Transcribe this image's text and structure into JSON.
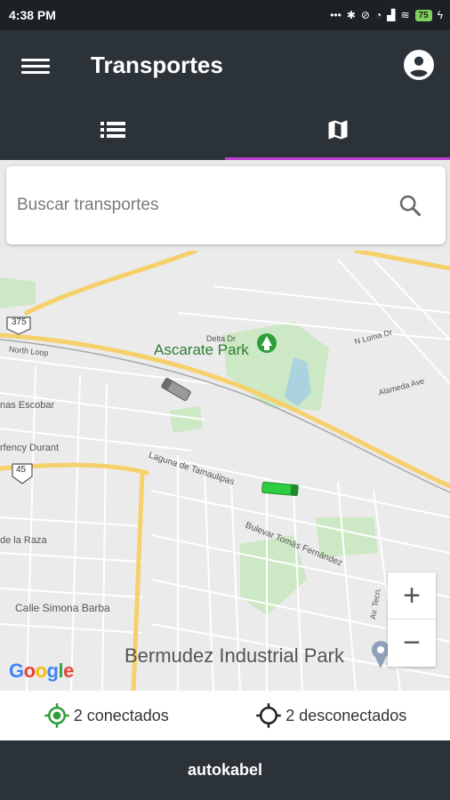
{
  "status_bar": {
    "time": "4:38 PM",
    "icons": [
      "dots-icon",
      "bluetooth-icon",
      "mute-icon",
      "alarm-icon",
      "signal-icon",
      "wifi-icon",
      "battery-icon",
      "charging-icon"
    ],
    "battery_level": "75"
  },
  "app_bar": {
    "title": "Transportes",
    "menu_icon": "hamburger-menu-icon",
    "account_icon": "account-circle-icon"
  },
  "tabs": [
    {
      "icon": "list-icon",
      "active": false
    },
    {
      "icon": "map-icon",
      "active": true
    }
  ],
  "colors": {
    "tab_indicator": "#c13bd6",
    "connected": "#2e9e3a",
    "disconnected": "#222222",
    "appbar": "#2b3238"
  },
  "search": {
    "placeholder": "Buscar transportes",
    "icon": "search-icon"
  },
  "map": {
    "labels": {
      "ascarate_park": "Ascarate Park",
      "bermudez_park": "Bermudez Industrial Park",
      "calle_simona": "Calle Simona Barba",
      "escobar": "nas Escobar",
      "durant": "rfency Durant",
      "raza": "de la Raza",
      "tamaulipas": "Laguna de Tamaulipas",
      "bulevar": "Bulevar Tomás Fernández",
      "delta": "Delta Dr",
      "lone": "N Loma Dr",
      "alameda": "Alameda Ave",
      "highway_375": "375",
      "highway_45": "45",
      "axon": "Av. Tecn.",
      "north": "North Loop"
    },
    "google_logo": "Google",
    "zoom_in": "+",
    "zoom_out": "−",
    "markers": [
      {
        "name": "vehicle-disconnected",
        "color": "#999999"
      },
      {
        "name": "vehicle-connected",
        "color": "#2ecc40"
      }
    ]
  },
  "legend": {
    "connected": "2 conectados",
    "disconnected": "2 desconectados"
  },
  "footer": {
    "text": "autokabel"
  }
}
